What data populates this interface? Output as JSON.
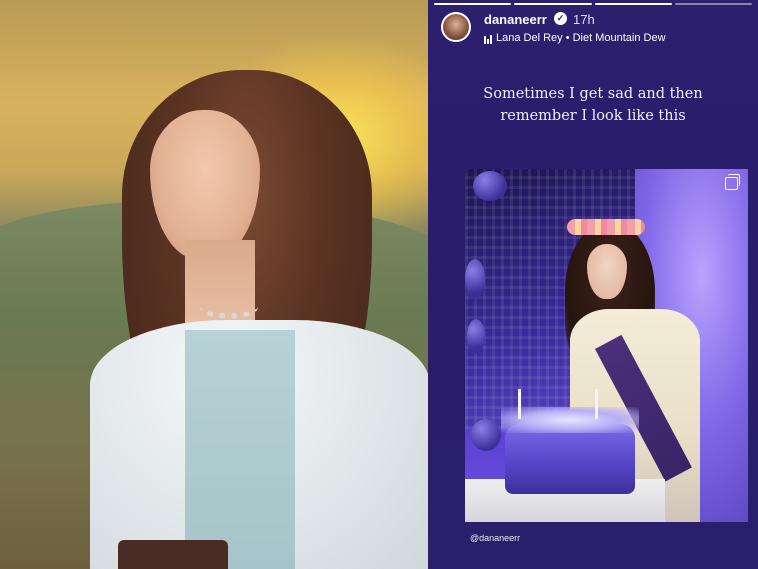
{
  "left_photo": {
    "alt_role": "portrait-photo"
  },
  "story": {
    "username": "dananeerr",
    "time": "17h",
    "music": "Lana Del Rey • Diet Mountain Dew",
    "caption_line1": "Sometimes I get sad and then",
    "caption_line2": "remember I look like this",
    "mention": "@dananeerr",
    "progress_segments": 4,
    "progress_active_index": 3
  }
}
